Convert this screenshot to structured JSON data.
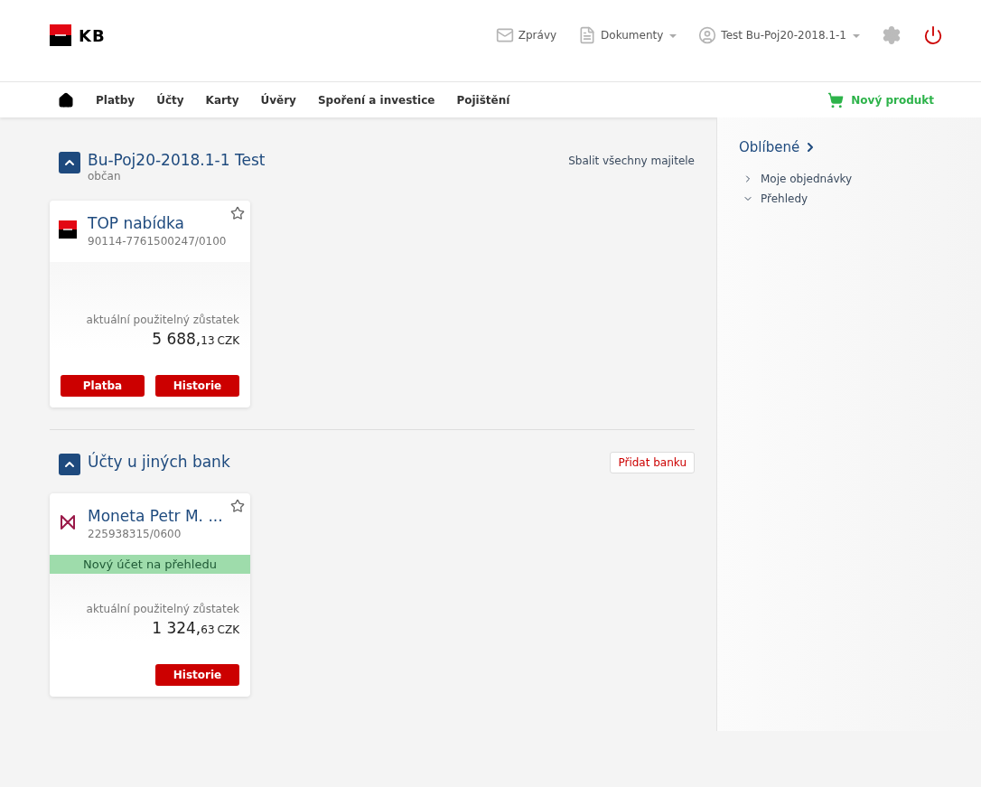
{
  "header": {
    "logo": "KB",
    "links": [
      {
        "kind": "mail",
        "label": "Zprávy",
        "dropdown": false
      },
      {
        "kind": "document",
        "label": "Dokumenty",
        "dropdown": true
      },
      {
        "kind": "user",
        "label": "Test Bu-Poj20-2018.1-1",
        "dropdown": true
      }
    ]
  },
  "nav": {
    "items": [
      "Platby",
      "Účty",
      "Karty",
      "Úvěry",
      "Spoření a investice",
      "Pojištění"
    ],
    "new_product": "Nový produkt"
  },
  "sections": [
    {
      "title": "Bu-Poj20-2018.1-1 Test",
      "subtitle": "občan",
      "expanded": true,
      "action": {
        "kind": "link",
        "label": "Sbalit všechny majitele"
      },
      "cards": [
        {
          "kind": "kb",
          "name": "TOP nabídka",
          "number": "90114-7761500247/0100",
          "favorite": false,
          "balance_label": "aktuální použitelný zůstatek",
          "amount_whole": "5 688,",
          "amount_decimal": "13",
          "currency": "CZK",
          "buttons": [
            "Platba",
            "Historie"
          ]
        }
      ]
    },
    {
      "title": "Účty u jiných bank",
      "expanded": true,
      "action": {
        "kind": "button",
        "label": "Přidat banku"
      },
      "cards": [
        {
          "kind": "moneta",
          "name": "Moneta Petr M. ...",
          "number": "225938315/0600",
          "favorite": false,
          "notice": "Nový účet na přehledu",
          "balance_label": "aktuální použitelný zůstatek",
          "amount_whole": "1 324,",
          "amount_decimal": "63",
          "currency": "CZK",
          "buttons": [
            "Historie"
          ]
        }
      ]
    }
  ],
  "sidebar": {
    "title": "Oblíbené",
    "items": [
      {
        "label": "Moje objednávky",
        "expanded": false
      },
      {
        "label": "Přehledy",
        "expanded": true
      }
    ]
  }
}
